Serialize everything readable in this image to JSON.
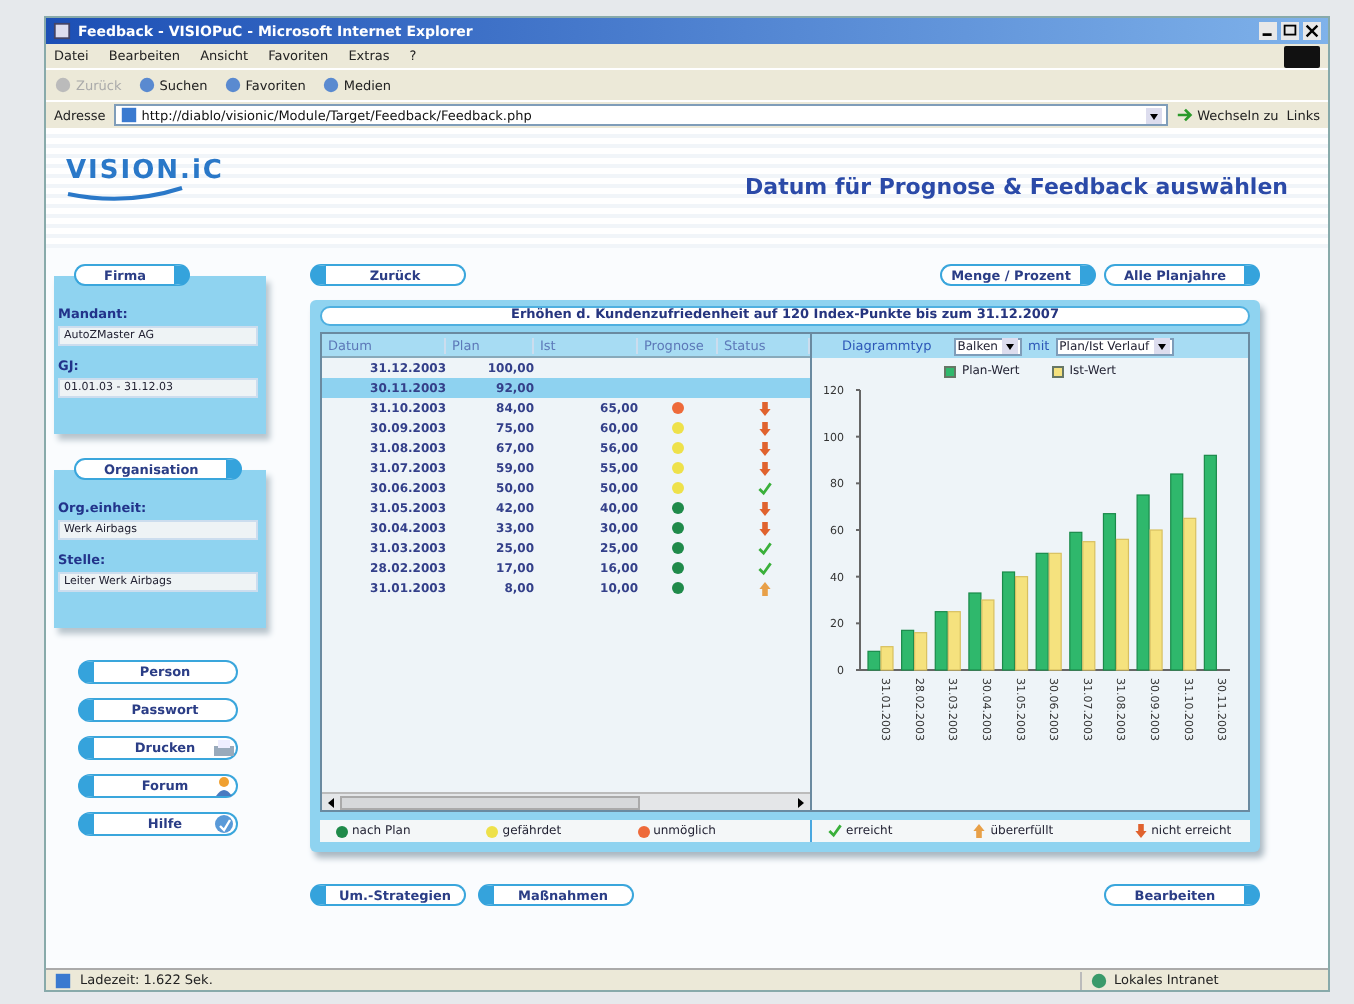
{
  "window": {
    "title": "Feedback - VISIOPuC - Microsoft Internet Explorer"
  },
  "menu": [
    "Datei",
    "Bearbeiten",
    "Ansicht",
    "Favoriten",
    "Extras",
    "?"
  ],
  "toolbar": [
    {
      "label": "Zurück",
      "disabled": true
    },
    {
      "label": "Suchen",
      "disabled": false
    },
    {
      "label": "Favoriten",
      "disabled": false
    },
    {
      "label": "Medien",
      "disabled": false
    }
  ],
  "address": {
    "label": "Adresse",
    "value": "http://diablo/visionic/Module/Target/Feedback/Feedback.php",
    "go": "Wechseln zu",
    "links": "Links"
  },
  "header": {
    "logo": "VISION.iC",
    "heading": "Datum für Prognose & Feedback auswählen"
  },
  "sidebar": {
    "panels": [
      {
        "title": "Firma",
        "fields": [
          {
            "label": "Mandant:",
            "value": "AutoZMaster AG"
          },
          {
            "label": "GJ:",
            "value": "01.01.03 - 31.12.03"
          }
        ]
      },
      {
        "title": "Organisation",
        "fields": [
          {
            "label": "Org.einheit:",
            "value": "Werk Airbags"
          },
          {
            "label": "Stelle:",
            "value": "Leiter Werk Airbags"
          }
        ]
      }
    ],
    "buttons": [
      {
        "label": "Person",
        "kind": "back"
      },
      {
        "label": "Passwort",
        "kind": "back"
      },
      {
        "label": "Drucken",
        "kind": "print"
      },
      {
        "label": "Forum",
        "kind": "forum"
      },
      {
        "label": "Hilfe",
        "kind": "help"
      }
    ]
  },
  "top_buttons": [
    {
      "label": "Zurück",
      "kind": "back"
    },
    {
      "label": "Menge / Prozent",
      "kind": "forward"
    },
    {
      "label": "Alle Planjahre",
      "kind": "forward"
    }
  ],
  "goal": "Erhöhen d. Kundenzufriedenheit auf 120 Index-Punkte bis zum 31.12.2007",
  "table": {
    "columns": [
      "Datum",
      "Plan",
      "Ist",
      "Prognose",
      "Status"
    ],
    "rows": [
      {
        "date": "31.12.2003",
        "plan": "100,00",
        "selected": false
      },
      {
        "date": "30.11.2003",
        "plan": "92,00",
        "selected": true
      },
      {
        "date": "31.10.2003",
        "plan": "84,00",
        "actual": "65,00",
        "prognose": {
          "kind": "unmoeglich"
        },
        "status": {
          "kind": "nicht_erreicht"
        },
        "selected": false
      },
      {
        "date": "30.09.2003",
        "plan": "75,00",
        "actual": "60,00",
        "prognose": {
          "kind": "gefaehrdet"
        },
        "status": {
          "kind": "nicht_erreicht"
        },
        "selected": false
      },
      {
        "date": "31.08.2003",
        "plan": "67,00",
        "actual": "56,00",
        "prognose": {
          "kind": "gefaehrdet"
        },
        "status": {
          "kind": "nicht_erreicht"
        },
        "selected": false
      },
      {
        "date": "31.07.2003",
        "plan": "59,00",
        "actual": "55,00",
        "prognose": {
          "kind": "gefaehrdet"
        },
        "status": {
          "kind": "nicht_erreicht"
        },
        "selected": false
      },
      {
        "date": "30.06.2003",
        "plan": "50,00",
        "actual": "50,00",
        "prognose": {
          "kind": "gefaehrdet"
        },
        "status": {
          "kind": "erreicht"
        },
        "selected": false
      },
      {
        "date": "31.05.2003",
        "plan": "42,00",
        "actual": "40,00",
        "prognose": {
          "kind": "nach_plan"
        },
        "status": {
          "kind": "nicht_erreicht"
        },
        "selected": false
      },
      {
        "date": "30.04.2003",
        "plan": "33,00",
        "actual": "30,00",
        "prognose": {
          "kind": "nach_plan"
        },
        "status": {
          "kind": "nicht_erreicht"
        },
        "selected": false
      },
      {
        "date": "31.03.2003",
        "plan": "25,00",
        "actual": "25,00",
        "prognose": {
          "kind": "nach_plan"
        },
        "status": {
          "kind": "erreicht"
        },
        "selected": false
      },
      {
        "date": "28.02.2003",
        "plan": "17,00",
        "actual": "16,00",
        "prognose": {
          "kind": "nach_plan"
        },
        "status": {
          "kind": "erreicht"
        },
        "selected": false
      },
      {
        "date": "31.01.2003",
        "plan": "8,00",
        "actual": "10,00",
        "prognose": {
          "kind": "nach_plan"
        },
        "status": {
          "kind": "uebererfuellt"
        },
        "selected": false
      }
    ]
  },
  "chart_controls": {
    "label": "Diagrammtyp",
    "type": "Balken",
    "with_label": "mit",
    "series": "Plan/Ist Verlauf"
  },
  "chart": {
    "chart_data": {
      "type": "bar",
      "categories": [
        "31.01.2003",
        "28.02.2003",
        "31.03.2003",
        "30.04.2003",
        "31.05.2003",
        "30.06.2003",
        "31.07.2003",
        "31.08.2003",
        "30.09.2003",
        "31.10.2003",
        "30.11.2003"
      ],
      "series": [
        {
          "name": "Plan-Wert",
          "color": "#2fb86c",
          "values": [
            8,
            17,
            25,
            33,
            42,
            50,
            59,
            67,
            75,
            84,
            92
          ]
        },
        {
          "name": "Ist-Wert",
          "color": "#f5e27e",
          "values": [
            10,
            16,
            25,
            30,
            40,
            50,
            55,
            56,
            60,
            65,
            null
          ]
        }
      ],
      "ylim": [
        0,
        120
      ],
      "yticks": [
        0,
        20,
        40,
        60,
        80,
        100,
        120
      ]
    }
  },
  "legend": [
    {
      "kind": "nach_plan",
      "label": "nach Plan"
    },
    {
      "kind": "gefaehrdet",
      "label": "gefährdet"
    },
    {
      "kind": "unmoeglich",
      "label": "unmöglich"
    },
    {
      "kind": "erreicht",
      "label": "erreicht"
    },
    {
      "kind": "uebererfuellt",
      "label": "übererfüllt"
    },
    {
      "kind": "nicht_erreicht",
      "label": "nicht erreicht"
    }
  ],
  "bottom_buttons": [
    {
      "label": "Um.-Strategien",
      "kind": "back"
    },
    {
      "label": "Maßnahmen",
      "kind": "back"
    },
    {
      "label": "Bearbeiten",
      "kind": "forward"
    }
  ],
  "status_bar": {
    "text": "Ladezeit: 1.622 Sek.",
    "zone": "Lokales Intranet"
  }
}
